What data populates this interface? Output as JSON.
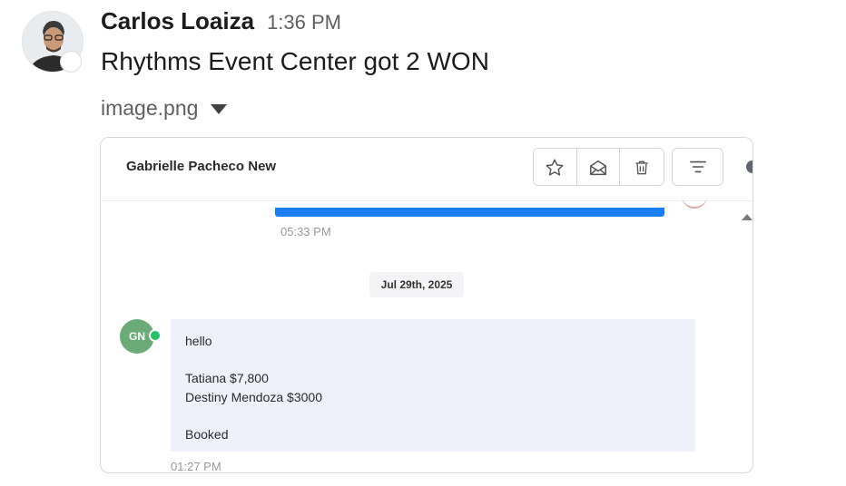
{
  "message": {
    "sender": "Carlos Loaiza",
    "time": "1:36 PM",
    "text": "Rhythms Event Center got 2 WON",
    "attachment": "image.png"
  },
  "screenshot": {
    "contact_name": "Gabrielle Pacheco New",
    "toolbar_icons": [
      "star-icon",
      "envelope-icon",
      "trash-icon",
      "filter-icon"
    ],
    "previous_time": "05:33 PM",
    "date_divider": "Jul 29th, 2025",
    "avatar_initials": "GN",
    "bubble_lines": [
      "hello",
      "",
      "Tatiana $7,800",
      "Destiny Mendoza $3000",
      "",
      "Booked"
    ],
    "bubble_time": "01:27 PM",
    "colors": {
      "accent_blue": "#1a7ff5",
      "avatar_green": "#6bab78",
      "bubble_bg": "#eef0fa"
    }
  }
}
